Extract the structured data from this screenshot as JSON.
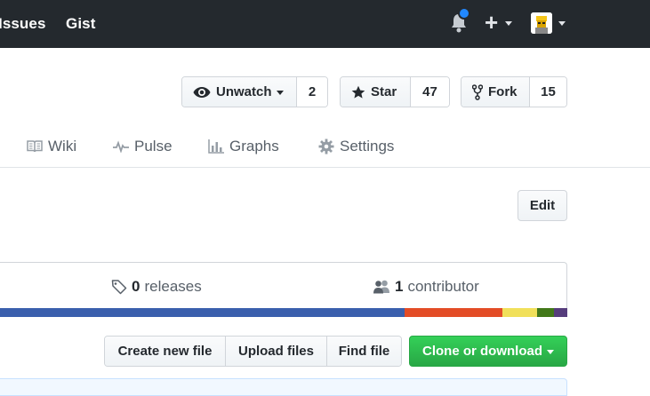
{
  "header": {
    "nav": [
      {
        "label": "Issues"
      },
      {
        "label": "Gist"
      }
    ],
    "icons": [
      "bell-icon",
      "plus-icon",
      "avatar"
    ],
    "notification_color": "#2188ff"
  },
  "repo_actions": {
    "watch": {
      "label": "Unwatch",
      "count": "2"
    },
    "star": {
      "label": "Star",
      "count": "47"
    },
    "fork": {
      "label": "Fork",
      "count": "15"
    }
  },
  "tabs": [
    {
      "label": "Wiki",
      "icon": "book-icon"
    },
    {
      "label": "Pulse",
      "icon": "pulse-icon"
    },
    {
      "label": "Graphs",
      "icon": "graph-icon"
    },
    {
      "label": "Settings",
      "icon": "gear-icon"
    }
  ],
  "edit_label": "Edit",
  "summary": {
    "releases": {
      "count": "0",
      "label": "releases"
    },
    "contributors": {
      "count": "1",
      "label": "contributor"
    }
  },
  "language_bar": [
    {
      "color": "#3a5fad",
      "share": 0.713
    },
    {
      "color": "#e34c26",
      "share": 0.172
    },
    {
      "color": "#f1e05a",
      "share": 0.061
    },
    {
      "color": "#427819",
      "share": 0.03
    },
    {
      "color": "#563d7c",
      "share": 0.024
    }
  ],
  "file_actions": {
    "create": "Create new file",
    "upload": "Upload files",
    "find": "Find file",
    "clone": "Clone or download"
  },
  "colors": {
    "header_bg": "#24292e",
    "clone_green": "#28a745"
  }
}
